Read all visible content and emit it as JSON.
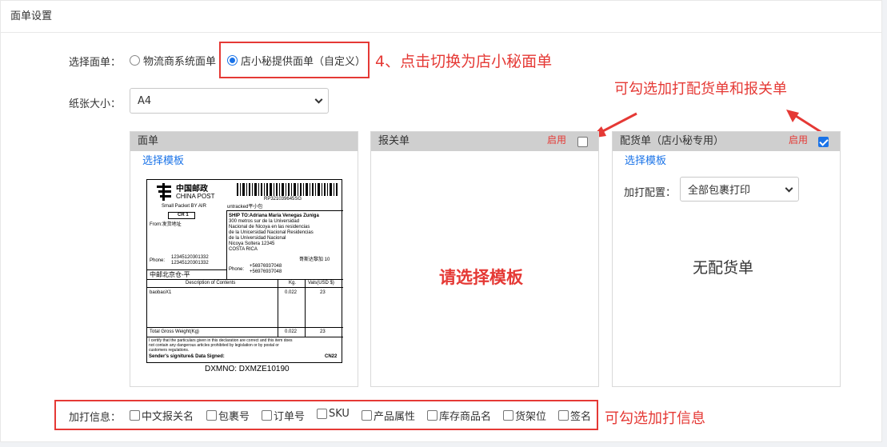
{
  "card": {
    "title": "面单设置"
  },
  "form": {
    "template_label": "选择面单：",
    "radio_options": [
      "物流商系统面单",
      "店小秘提供面单（自定义）"
    ],
    "paper_label": "纸张大小：",
    "paper_value": "A4"
  },
  "panels": {
    "waybill": {
      "title": "面单",
      "link": "选择模板"
    },
    "customs": {
      "title": "报关单",
      "enable": "启用",
      "placeholder": "请选择模板"
    },
    "picking": {
      "title": "配货单（店小秘专用）",
      "enable": "启用",
      "link": "选择模板",
      "config_label": "加打配置：",
      "config_value": "全部包裹打印",
      "empty": "无配货单"
    }
  },
  "extra": {
    "label": "加打信息：",
    "options": [
      "中文报关名",
      "包裹号",
      "订单号",
      "SKU",
      "产品属性",
      "库存商品名",
      "货架位",
      "签名"
    ]
  },
  "annotations": {
    "step4": "4、点击切换为店小秘面单",
    "checkable": "可勾选加打配货单和报关单",
    "extra": "可勾选加打信息"
  },
  "shipping_label": {
    "logo_cn": "中国邮政",
    "logo_en": "CHINA POST",
    "tracking": "RP321039645SG",
    "service": "Small Packet BY AIR",
    "untracked": "untracked平小包",
    "cr": "CR 1",
    "from": "From:发货地址",
    "ship_to": "SHIP TO:Adriana Maria Venegas Zuniga",
    "address": [
      "300 metros sur de la Universidad",
      "Nacional de Nicoya en las residencias",
      "de la Unicersidad Nacional Residencias",
      "de la Universidad Nacional",
      "Nicoya Soltera 12345",
      "COSTA RICA"
    ],
    "phone_from_label": "Phone:",
    "phone_from": [
      "12345120301332",
      "12345120301332"
    ],
    "phone_to_label": "Phone:",
    "phone_to": [
      "+56976937048",
      "+56976937048"
    ],
    "region": "哥斯达黎加 10",
    "origin": "中邮北京仓-平",
    "table_head": [
      "Description of Contents",
      "Kg.",
      "Vals(USD $)"
    ],
    "item": [
      "baobaoX1",
      "0.022",
      "23"
    ],
    "total": [
      "Total Gross Weight(Kg)",
      "0.022",
      "23"
    ],
    "certify": [
      "I certify that the particulars given in this declaration are correct and this item does",
      "not contain any dangerous articles prohibited by legislation or by postal or",
      "customers regulations."
    ],
    "signature": "Sender's signiture& Data Signed:",
    "cn22": "CN22",
    "dxm": "DXMNO: DXMZE10190"
  },
  "colors": {
    "accent": "#1a73e8",
    "annotation": "#e53935",
    "panel_header": "#cfcfcf"
  }
}
